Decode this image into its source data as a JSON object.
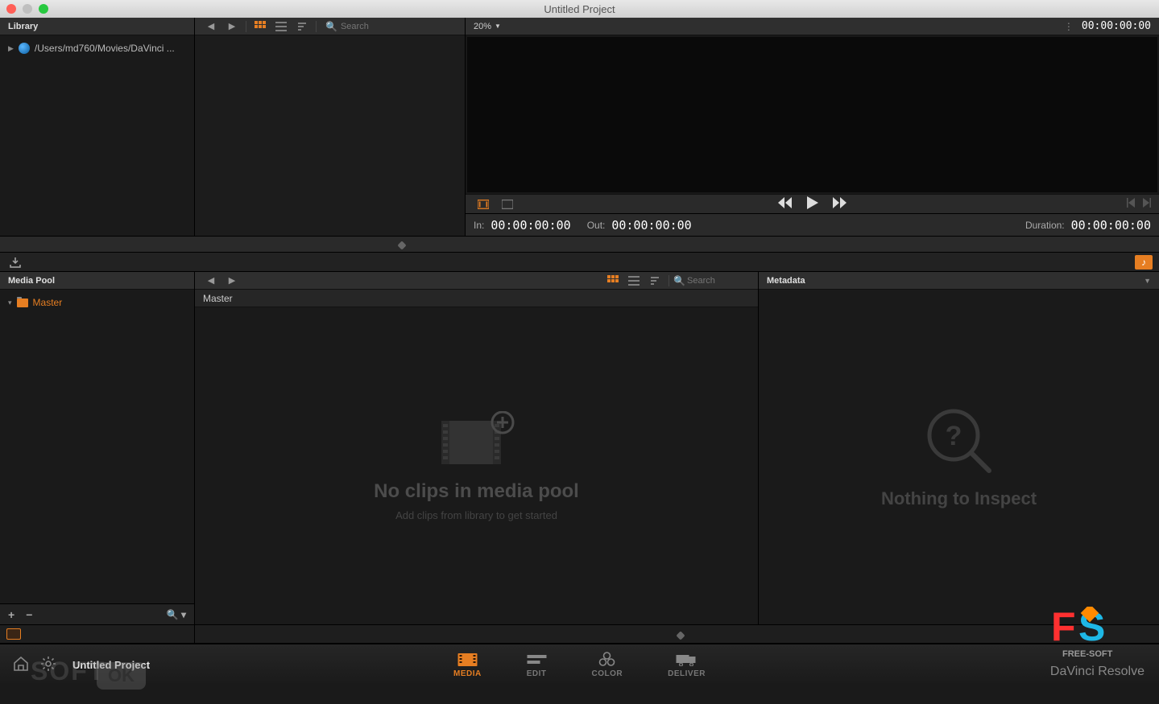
{
  "window": {
    "title": "Untitled Project"
  },
  "library": {
    "header": "Library",
    "path": "/Users/md760/Movies/DaVinci ..."
  },
  "browser": {
    "search_placeholder": "Search"
  },
  "viewer": {
    "zoom": "20%",
    "timecode": "00:00:00:00",
    "in_label": "In:",
    "in_value": "00:00:00:00",
    "out_label": "Out:",
    "out_value": "00:00:00:00",
    "dur_label": "Duration:",
    "dur_value": "00:00:00:00"
  },
  "pool": {
    "header": "Media Pool",
    "master": "Master",
    "sub": "Master",
    "search_placeholder": "Search",
    "empty_title": "No clips in media pool",
    "empty_sub": "Add clips from library to get started"
  },
  "metadata": {
    "header": "Metadata",
    "empty_title": "Nothing to Inspect"
  },
  "footer": {
    "project": "Untitled Project",
    "pages": {
      "media": "MEDIA",
      "edit": "EDIT",
      "color": "COLOR",
      "deliver": "DELIVER"
    },
    "brand": "DaVinci Resolve"
  },
  "watermark": {
    "soft": "SOFT",
    "ok": "OK",
    "freesoft": "FREE-SOFT"
  }
}
